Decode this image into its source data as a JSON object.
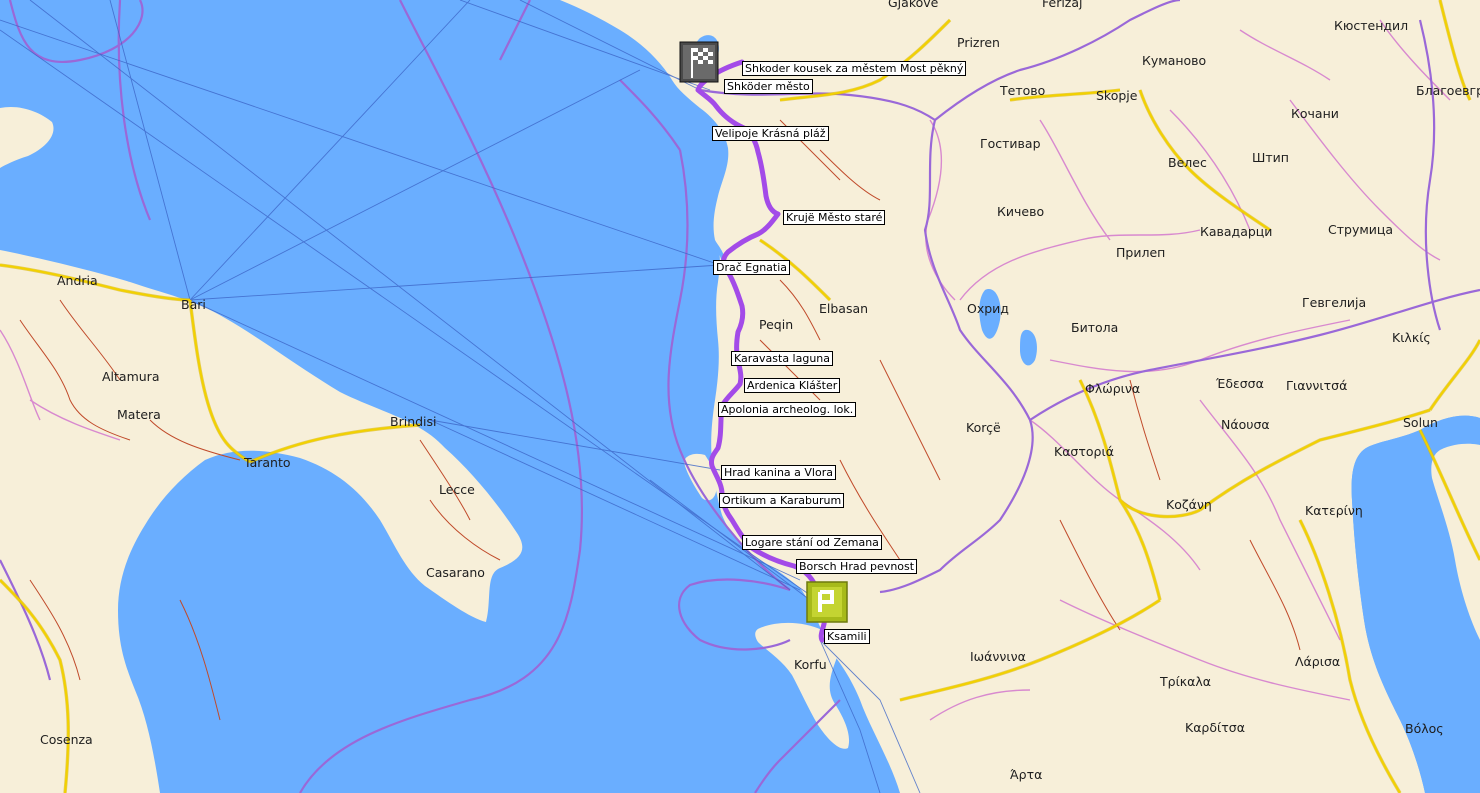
{
  "colors": {
    "sea": "#6aaeff",
    "land": "#f7efd9",
    "border_admin": "#d889cf",
    "border_national": "#9a68d8",
    "road_major": "#f2d100",
    "road_minor": "#c04a2a",
    "route": "#a34be8",
    "ferry_line": "#3d66c8"
  },
  "cities": [
    {
      "id": "gjakove",
      "name": "Gjakove"
    },
    {
      "id": "ferizaj",
      "name": "Ferizaj"
    },
    {
      "id": "kyustendil",
      "name": "Кюстендил"
    },
    {
      "id": "prizren",
      "name": "Prizren"
    },
    {
      "id": "kumanovo",
      "name": "Куманово"
    },
    {
      "id": "tetovo",
      "name": "Тетово"
    },
    {
      "id": "skopje",
      "name": "Skopje"
    },
    {
      "id": "blagoevgrad",
      "name": "Благоевгр"
    },
    {
      "id": "kochani",
      "name": "Кочани"
    },
    {
      "id": "gostivar",
      "name": "Гостивар"
    },
    {
      "id": "veles",
      "name": "Велес"
    },
    {
      "id": "shtip",
      "name": "Штип"
    },
    {
      "id": "kichevo",
      "name": "Кичево"
    },
    {
      "id": "kavadarci",
      "name": "Кавадарци"
    },
    {
      "id": "strumica",
      "name": "Струмица"
    },
    {
      "id": "prilep",
      "name": "Прилеп"
    },
    {
      "id": "andria",
      "name": "Andria"
    },
    {
      "id": "bari",
      "name": "Bari"
    },
    {
      "id": "elbasan",
      "name": "Elbasan"
    },
    {
      "id": "gevgelija",
      "name": "Гевгелија"
    },
    {
      "id": "ohrid",
      "name": "Охрид"
    },
    {
      "id": "peqin",
      "name": "Peqin"
    },
    {
      "id": "bitola",
      "name": "Битола"
    },
    {
      "id": "kilkis",
      "name": "Κιλκίς"
    },
    {
      "id": "altamura",
      "name": "Altamura"
    },
    {
      "id": "florina",
      "name": "Φλώρινα"
    },
    {
      "id": "edessa",
      "name": "Έδεσσα"
    },
    {
      "id": "giannitsa",
      "name": "Γιαννιτσά"
    },
    {
      "id": "matera",
      "name": "Matera"
    },
    {
      "id": "brindisi",
      "name": "Brindisi"
    },
    {
      "id": "naousa",
      "name": "Νάουσα"
    },
    {
      "id": "korce",
      "name": "Korçë"
    },
    {
      "id": "solun",
      "name": "Solun"
    },
    {
      "id": "kastoria",
      "name": "Καστοριά"
    },
    {
      "id": "taranto",
      "name": "Taranto"
    },
    {
      "id": "lecce",
      "name": "Lecce"
    },
    {
      "id": "kozani",
      "name": "Κοζάνη"
    },
    {
      "id": "katerini",
      "name": "Κατερίνη"
    },
    {
      "id": "casarano",
      "name": "Casarano"
    },
    {
      "id": "korfu",
      "name": "Korfu"
    },
    {
      "id": "ioannina",
      "name": "Ιωάννινα"
    },
    {
      "id": "larisa",
      "name": "Λάρισα"
    },
    {
      "id": "trikala",
      "name": "Τρίκαλα"
    },
    {
      "id": "karditsa",
      "name": "Καρδίτσα"
    },
    {
      "id": "volos",
      "name": "Βόλος"
    },
    {
      "id": "cosenza",
      "name": "Cosenza"
    },
    {
      "id": "arta",
      "name": "Άρτα"
    }
  ],
  "waypoints": [
    {
      "id": "shkoder-most",
      "label": "Shkoder kousek za městem Most pěkný"
    },
    {
      "id": "shkoder-mesto",
      "label": "Shköder město"
    },
    {
      "id": "velipoje",
      "label": "Velipoje Krásná pláž"
    },
    {
      "id": "kruje",
      "label": "Krujë Město staré"
    },
    {
      "id": "drac",
      "label": "Drač Egnatia"
    },
    {
      "id": "karavasta",
      "label": "Karavasta laguna"
    },
    {
      "id": "ardenica",
      "label": "Ardenica Klášter"
    },
    {
      "id": "apolonia",
      "label": "Apolonia archeolog. lok."
    },
    {
      "id": "kanina",
      "label": "Hrad kanina a Vlora"
    },
    {
      "id": "ortikum",
      "label": "Ortikum a Karaburum"
    },
    {
      "id": "logare",
      "label": "Logare stání od Zemana"
    },
    {
      "id": "borsch",
      "label": "Borsch Hrad pevnost"
    },
    {
      "id": "ksamili",
      "label": "Ksamili"
    }
  ],
  "markers": {
    "finish_icon": "checkered-flag-icon",
    "parking_icon": "parking-icon"
  }
}
